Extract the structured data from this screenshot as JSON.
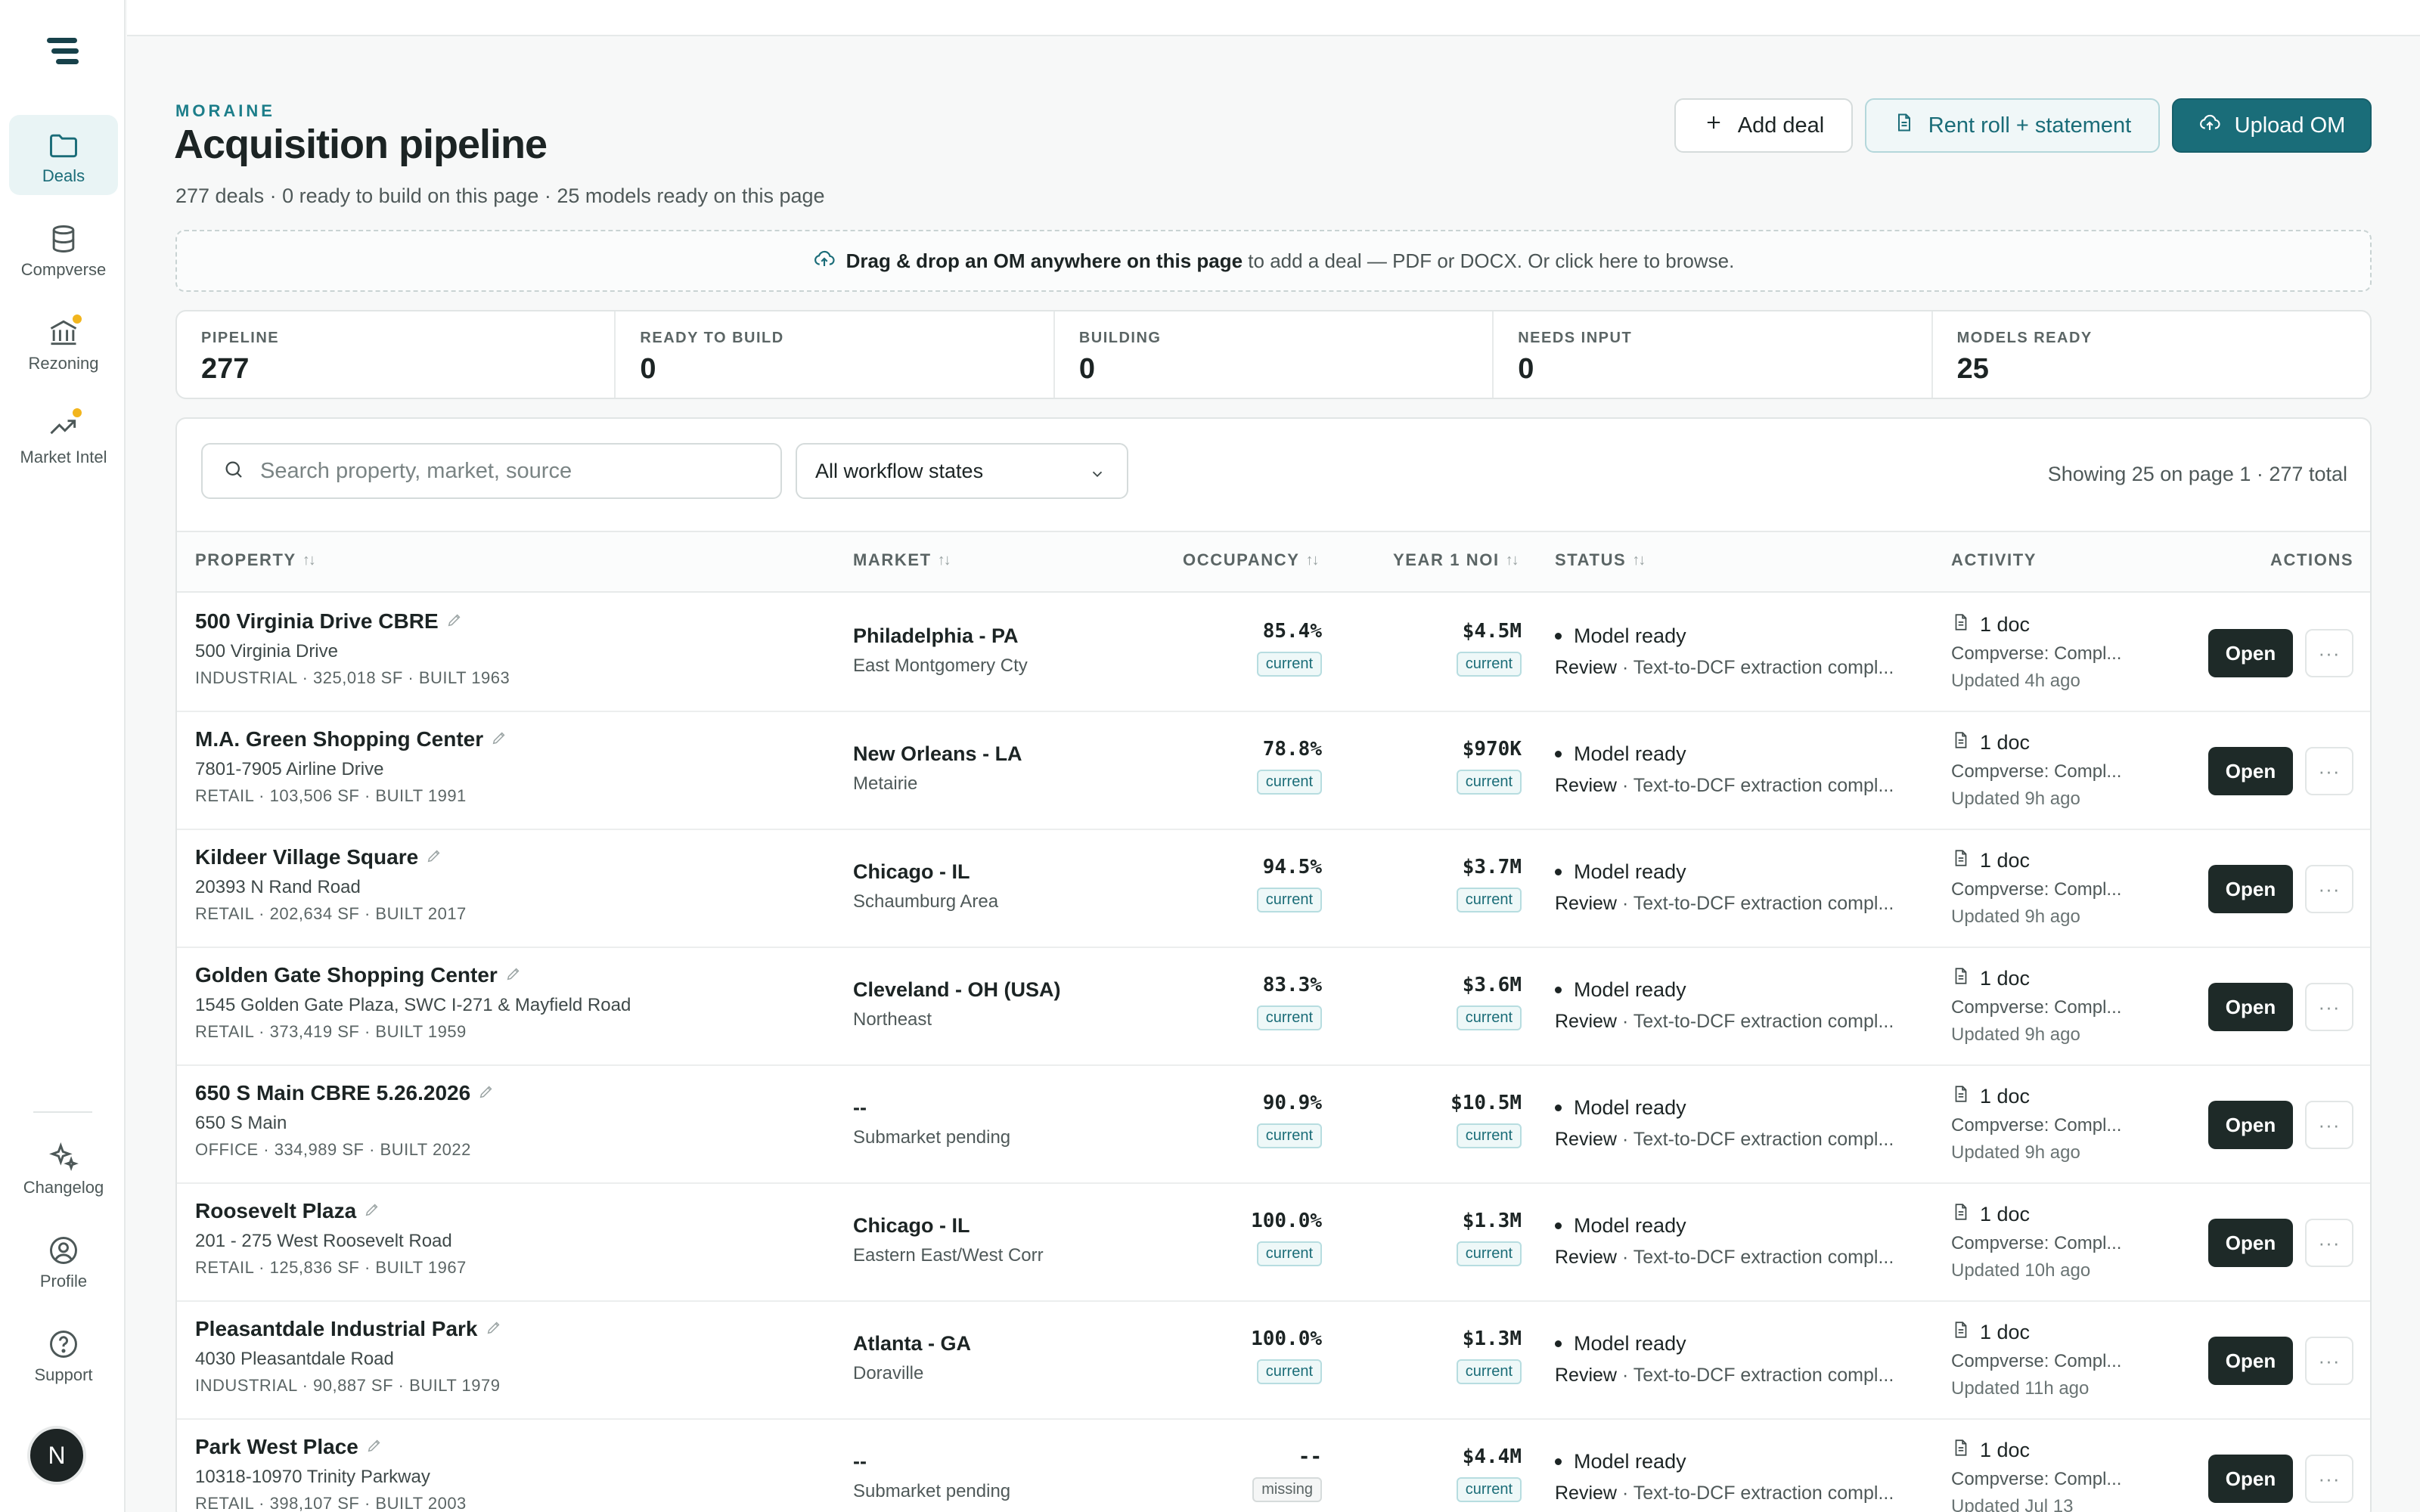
{
  "sidebar": {
    "items": [
      {
        "label": "Deals",
        "icon": "folder-icon"
      },
      {
        "label": "Compverse",
        "icon": "database-icon"
      },
      {
        "label": "Rezoning",
        "icon": "bank-icon"
      },
      {
        "label": "Market Intel",
        "icon": "trend-up-icon"
      }
    ],
    "bottom_items": [
      {
        "label": "Changelog",
        "icon": "sparkle-icon"
      },
      {
        "label": "Profile",
        "icon": "user-circle-icon"
      },
      {
        "label": "Support",
        "icon": "help-circle-icon"
      }
    ],
    "avatar_initial": "N"
  },
  "header": {
    "brand": "MORAINE",
    "title": "Acquisition pipeline",
    "subtitle": "277 deals · 0 ready to build on this page · 25 models ready on this page",
    "buttons": {
      "add": "Add deal",
      "rent": "Rent roll + statement",
      "upload": "Upload OM"
    }
  },
  "dropzone": {
    "bold": "Drag & drop an OM anywhere on this page",
    "rest": "to add a deal — PDF or DOCX. Or click here to browse."
  },
  "stats": [
    {
      "label": "PIPELINE",
      "value": "277"
    },
    {
      "label": "READY TO BUILD",
      "value": "0"
    },
    {
      "label": "BUILDING",
      "value": "0"
    },
    {
      "label": "NEEDS INPUT",
      "value": "0"
    },
    {
      "label": "MODELS READY",
      "value": "25"
    }
  ],
  "filters": {
    "search_placeholder": "Search property, market, source",
    "workflow_state": "All workflow states",
    "showing": "Showing 25 on page 1 · 277 total"
  },
  "columns": {
    "property": "PROPERTY",
    "market": "MARKET",
    "occupancy": "OCCUPANCY",
    "noi": "YEAR 1 NOI",
    "status": "STATUS",
    "activity": "ACTIVITY",
    "actions": "ACTIONS"
  },
  "rows": [
    {
      "name": "500 Virginia Drive CBRE",
      "address": "500 Virginia Drive",
      "meta": "INDUSTRIAL · 325,018 SF · BUILT 1963",
      "city": "Philadelphia - PA",
      "submarket": "East Montgomery Cty",
      "occupancy": "85.4%",
      "occ_tag": "current",
      "noi": "$4.5M",
      "noi_tag": "current",
      "status": "Model ready",
      "status_label": "Review",
      "status_detail": "· Text-to-DCF extraction compl...",
      "docs": "1 doc",
      "source": "Compverse: Compl...",
      "updated": "Updated 4h ago",
      "open": "Open"
    },
    {
      "name": "M.A. Green Shopping Center",
      "address": "7801-7905 Airline Drive",
      "meta": "RETAIL · 103,506 SF · BUILT 1991",
      "city": "New Orleans - LA",
      "submarket": "Metairie",
      "occupancy": "78.8%",
      "occ_tag": "current",
      "noi": "$970K",
      "noi_tag": "current",
      "status": "Model ready",
      "status_label": "Review",
      "status_detail": "· Text-to-DCF extraction compl...",
      "docs": "1 doc",
      "source": "Compverse: Compl...",
      "updated": "Updated 9h ago",
      "open": "Open"
    },
    {
      "name": "Kildeer Village Square",
      "address": "20393 N Rand Road",
      "meta": "RETAIL · 202,634 SF · BUILT 2017",
      "city": "Chicago - IL",
      "submarket": "Schaumburg Area",
      "occupancy": "94.5%",
      "occ_tag": "current",
      "noi": "$3.7M",
      "noi_tag": "current",
      "status": "Model ready",
      "status_label": "Review",
      "status_detail": "· Text-to-DCF extraction compl...",
      "docs": "1 doc",
      "source": "Compverse: Compl...",
      "updated": "Updated 9h ago",
      "open": "Open"
    },
    {
      "name": "Golden Gate Shopping Center",
      "address": "1545 Golden Gate Plaza, SWC I-271 & Mayfield Road",
      "meta": "RETAIL · 373,419 SF · BUILT 1959",
      "city": "Cleveland - OH (USA)",
      "submarket": "Northeast",
      "occupancy": "83.3%",
      "occ_tag": "current",
      "noi": "$3.6M",
      "noi_tag": "current",
      "status": "Model ready",
      "status_label": "Review",
      "status_detail": "· Text-to-DCF extraction compl...",
      "docs": "1 doc",
      "source": "Compverse: Compl...",
      "updated": "Updated 9h ago",
      "open": "Open"
    },
    {
      "name": "650 S Main CBRE 5.26.2026",
      "address": "650 S Main",
      "meta": "OFFICE · 334,989 SF · BUILT 2022",
      "city": "--",
      "submarket": "Submarket pending",
      "occupancy": "90.9%",
      "occ_tag": "current",
      "noi": "$10.5M",
      "noi_tag": "current",
      "status": "Model ready",
      "status_label": "Review",
      "status_detail": "· Text-to-DCF extraction compl...",
      "docs": "1 doc",
      "source": "Compverse: Compl...",
      "updated": "Updated 9h ago",
      "open": "Open"
    },
    {
      "name": "Roosevelt Plaza",
      "address": "201 - 275 West Roosevelt Road",
      "meta": "RETAIL · 125,836 SF · BUILT 1967",
      "city": "Chicago - IL",
      "submarket": "Eastern East/West Corr",
      "occupancy": "100.0%",
      "occ_tag": "current",
      "noi": "$1.3M",
      "noi_tag": "current",
      "status": "Model ready",
      "status_label": "Review",
      "status_detail": "· Text-to-DCF extraction compl...",
      "docs": "1 doc",
      "source": "Compverse: Compl...",
      "updated": "Updated 10h ago",
      "open": "Open"
    },
    {
      "name": "Pleasantdale Industrial Park",
      "address": "4030 Pleasantdale Road",
      "meta": "INDUSTRIAL · 90,887 SF · BUILT 1979",
      "city": "Atlanta - GA",
      "submarket": "Doraville",
      "occupancy": "100.0%",
      "occ_tag": "current",
      "noi": "$1.3M",
      "noi_tag": "current",
      "status": "Model ready",
      "status_label": "Review",
      "status_detail": "· Text-to-DCF extraction compl...",
      "docs": "1 doc",
      "source": "Compverse: Compl...",
      "updated": "Updated 11h ago",
      "open": "Open"
    },
    {
      "name": "Park West Place",
      "address": "10318-10970 Trinity Parkway",
      "meta": "RETAIL · 398,107 SF · BUILT 2003",
      "city": "--",
      "submarket": "Submarket pending",
      "occupancy": "--",
      "occ_tag": "missing",
      "noi": "$4.4M",
      "noi_tag": "current",
      "status": "Model ready",
      "status_label": "Review",
      "status_detail": "· Text-to-DCF extraction compl...",
      "docs": "1 doc",
      "source": "Compverse: Compl...",
      "updated": "Updated Jul 13",
      "open": "Open"
    }
  ]
}
